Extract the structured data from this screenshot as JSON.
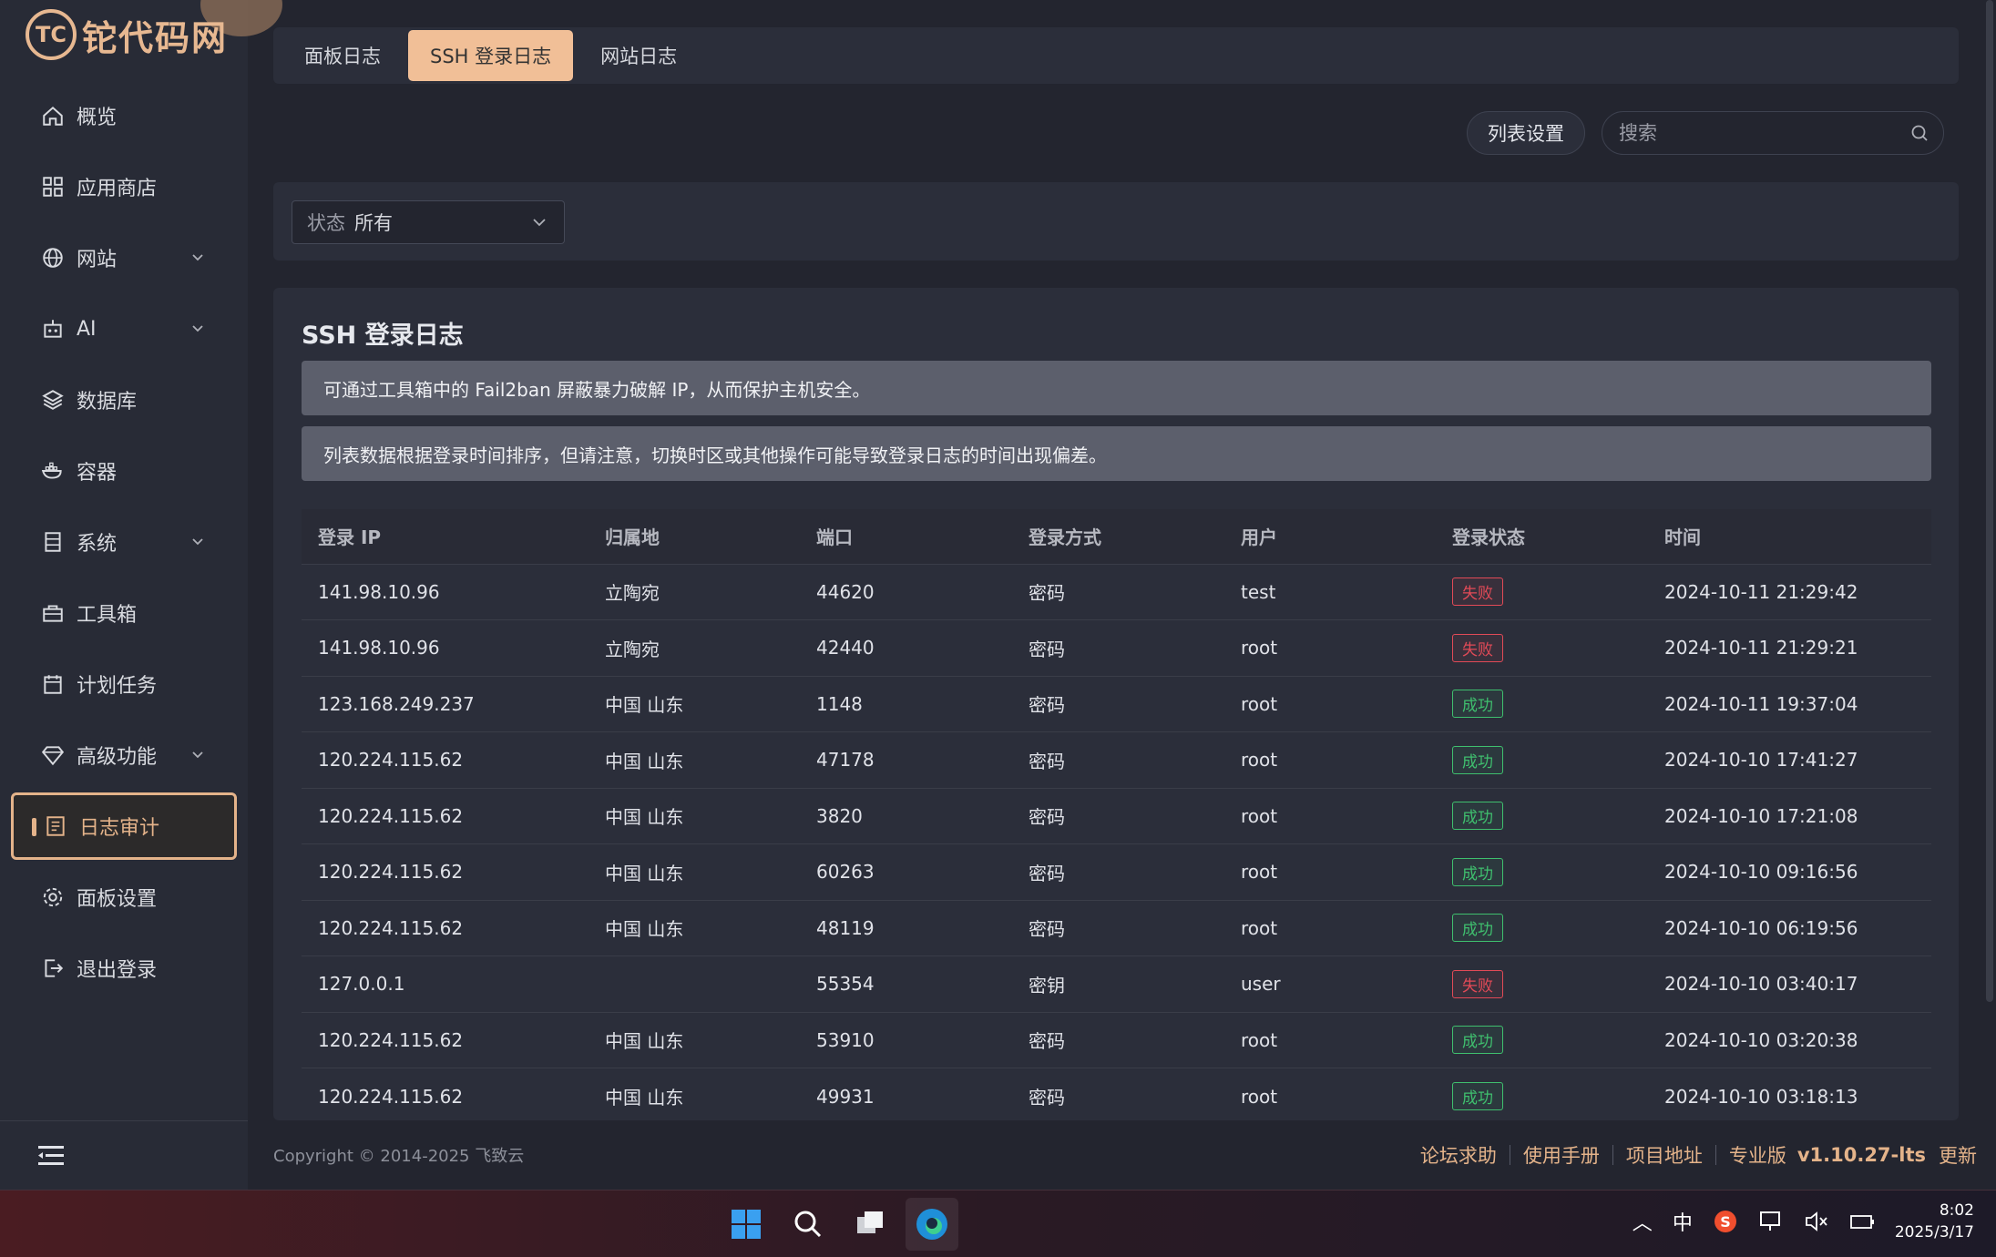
{
  "app": {
    "logo_text": "铊代码网",
    "logo_badge": "TC"
  },
  "sidebar": {
    "items": [
      {
        "label": "概览",
        "icon": "home-icon",
        "has_chevron": false
      },
      {
        "label": "应用商店",
        "icon": "grid-icon",
        "has_chevron": false
      },
      {
        "label": "网站",
        "icon": "globe-icon",
        "has_chevron": true
      },
      {
        "label": "AI",
        "icon": "robot-icon",
        "has_chevron": true
      },
      {
        "label": "数据库",
        "icon": "layers-icon",
        "has_chevron": false
      },
      {
        "label": "容器",
        "icon": "docker-icon",
        "has_chevron": false
      },
      {
        "label": "系统",
        "icon": "server-icon",
        "has_chevron": true
      },
      {
        "label": "工具箱",
        "icon": "toolbox-icon",
        "has_chevron": false
      },
      {
        "label": "计划任务",
        "icon": "calendar-icon",
        "has_chevron": false
      },
      {
        "label": "高级功能",
        "icon": "diamond-icon",
        "has_chevron": true
      },
      {
        "label": "日志审计",
        "icon": "log-icon",
        "has_chevron": false,
        "active": true
      },
      {
        "label": "面板设置",
        "icon": "gear-icon",
        "has_chevron": false
      },
      {
        "label": "退出登录",
        "icon": "logout-icon",
        "has_chevron": false
      }
    ]
  },
  "tabs": [
    {
      "label": "面板日志",
      "active": false
    },
    {
      "label": "SSH 登录日志",
      "active": true
    },
    {
      "label": "网站日志",
      "active": false
    }
  ],
  "toolbar": {
    "column_settings_label": "列表设置",
    "search_placeholder": "搜索"
  },
  "filter": {
    "label": "状态",
    "value": "所有"
  },
  "panel": {
    "title": "SSH 登录日志",
    "alert1": "可通过工具箱中的 Fail2ban 屏蔽暴力破解 IP，从而保护主机安全。",
    "alert2": "列表数据根据登录时间排序，但请注意，切换时区或其他操作可能导致登录日志的时间出现偏差。"
  },
  "table": {
    "columns": [
      "登录 IP",
      "归属地",
      "端口",
      "登录方式",
      "用户",
      "登录状态",
      "时间"
    ],
    "rows": [
      {
        "ip": "141.98.10.96",
        "location": "立陶宛",
        "port": "44620",
        "method": "密码",
        "user": "test",
        "status": "失败",
        "status_type": "fail",
        "time": "2024-10-11 21:29:42"
      },
      {
        "ip": "141.98.10.96",
        "location": "立陶宛",
        "port": "42440",
        "method": "密码",
        "user": "root",
        "status": "失败",
        "status_type": "fail",
        "time": "2024-10-11 21:29:21"
      },
      {
        "ip": "123.168.249.237",
        "location": "中国 山东",
        "port": "1148",
        "method": "密码",
        "user": "root",
        "status": "成功",
        "status_type": "ok",
        "time": "2024-10-11 19:37:04"
      },
      {
        "ip": "120.224.115.62",
        "location": "中国 山东",
        "port": "47178",
        "method": "密码",
        "user": "root",
        "status": "成功",
        "status_type": "ok",
        "time": "2024-10-10 17:41:27"
      },
      {
        "ip": "120.224.115.62",
        "location": "中国 山东",
        "port": "3820",
        "method": "密码",
        "user": "root",
        "status": "成功",
        "status_type": "ok",
        "time": "2024-10-10 17:21:08"
      },
      {
        "ip": "120.224.115.62",
        "location": "中国 山东",
        "port": "60263",
        "method": "密码",
        "user": "root",
        "status": "成功",
        "status_type": "ok",
        "time": "2024-10-10 09:16:56"
      },
      {
        "ip": "120.224.115.62",
        "location": "中国 山东",
        "port": "48119",
        "method": "密码",
        "user": "root",
        "status": "成功",
        "status_type": "ok",
        "time": "2024-10-10 06:19:56"
      },
      {
        "ip": "127.0.0.1",
        "location": "",
        "port": "55354",
        "method": "密钥",
        "user": "user",
        "status": "失败",
        "status_type": "fail",
        "time": "2024-10-10 03:40:17"
      },
      {
        "ip": "120.224.115.62",
        "location": "中国 山东",
        "port": "53910",
        "method": "密码",
        "user": "root",
        "status": "成功",
        "status_type": "ok",
        "time": "2024-10-10 03:20:38"
      },
      {
        "ip": "120.224.115.62",
        "location": "中国 山东",
        "port": "49931",
        "method": "密码",
        "user": "root",
        "status": "成功",
        "status_type": "ok",
        "time": "2024-10-10 03:18:13"
      }
    ]
  },
  "footer": {
    "copyright": "Copyright © 2014-2025 飞致云",
    "links": [
      "论坛求助",
      "使用手册",
      "项目地址",
      "专业版"
    ],
    "version": "v1.10.27-lts",
    "update": "更新"
  },
  "taskbar": {
    "ime": "中",
    "time": "8:02",
    "date": "2025/3/17"
  },
  "colors": {
    "accent": "#e4b38a",
    "tab_active_bg": "#f1bf97",
    "fail": "#e24a57",
    "success": "#3fbf6e"
  }
}
